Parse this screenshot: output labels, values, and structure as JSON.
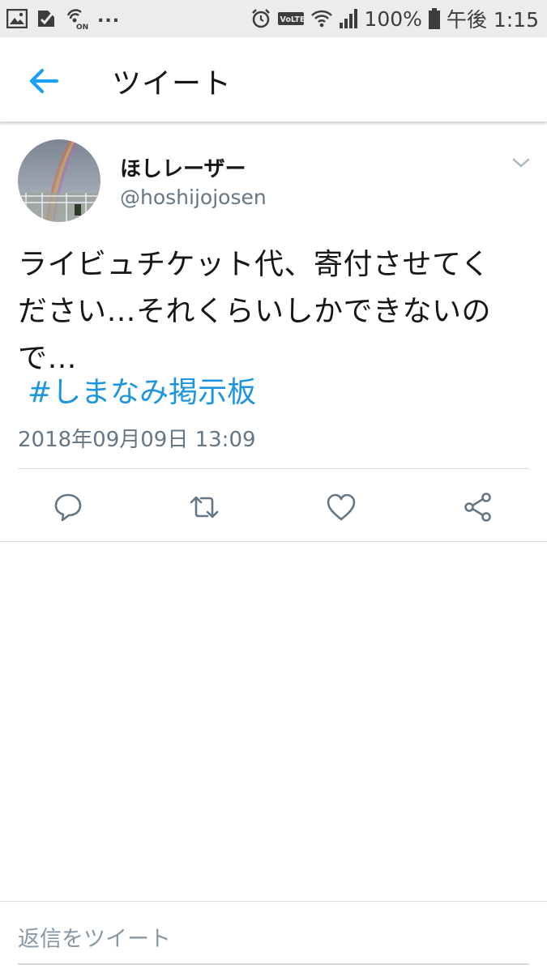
{
  "status_bar": {
    "left_icons": [
      "image-icon",
      "check-icon",
      "nfc-on-icon"
    ],
    "more": "...",
    "right_icons": [
      "alarm-icon",
      "volte-icon",
      "wifi-icon",
      "signal-icon",
      "battery-icon"
    ],
    "volte": "VoLTE",
    "battery": "100%",
    "time": "午後 1:15"
  },
  "header": {
    "back_icon": "arrow-left-icon",
    "title": "ツイート"
  },
  "tweet": {
    "display_name": "ほしレーザー",
    "screen_name": "@hoshijojosen",
    "text": "ライビュチケット代、寄付させてく\nださい…それくらいしかできないの\nで…",
    "hashtag": "#しまなみ掲示板",
    "timestamp": "2018年09月09日 13:09",
    "actions": [
      "reply-icon",
      "retweet-icon",
      "like-icon",
      "share-icon"
    ]
  },
  "reply_bar": {
    "placeholder": "返信をツイート"
  },
  "colors": {
    "accent": "#1da1f2",
    "link": "#1b95e0",
    "text": "#14171a",
    "secondary": "#657786",
    "icon": "#657786",
    "divider": "#d6dde3",
    "status_bar_bg": "#ececec"
  }
}
